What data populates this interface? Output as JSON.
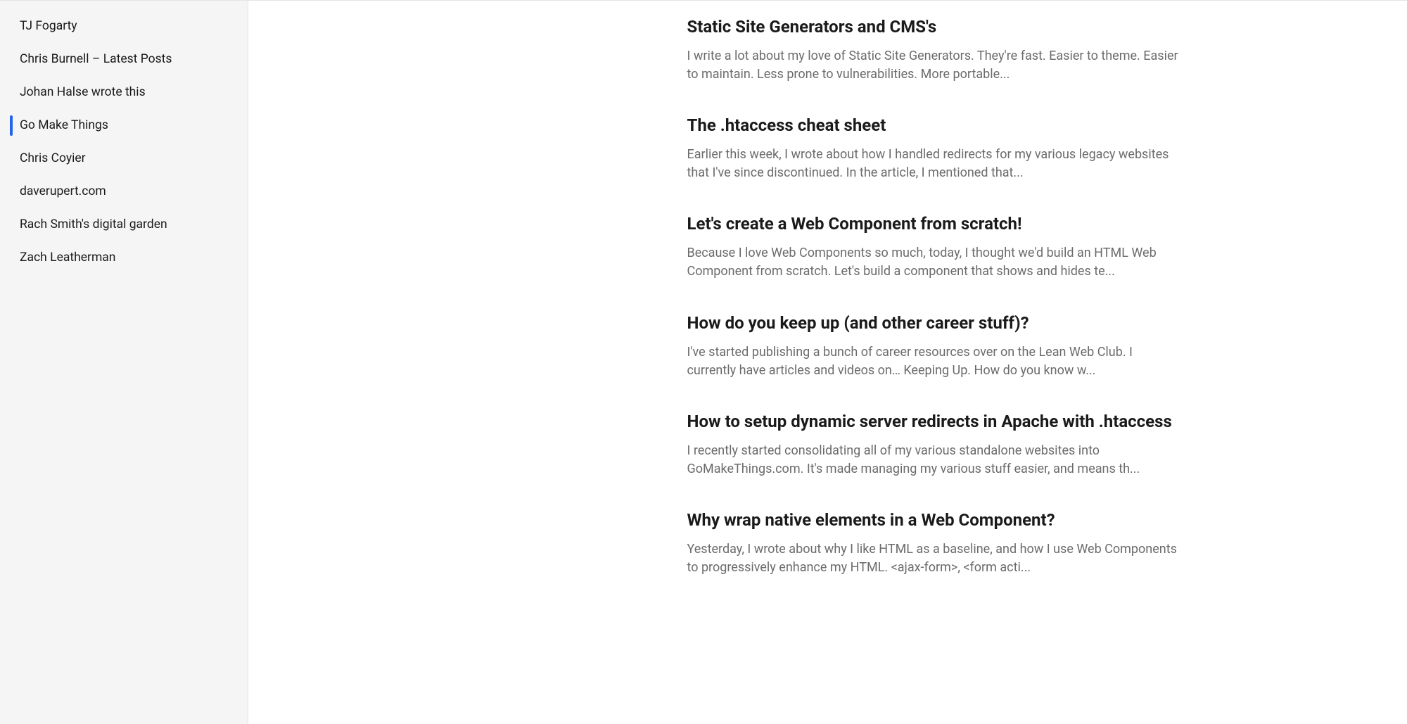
{
  "sidebar": {
    "items": [
      {
        "label": "TJ Fogarty",
        "active": false
      },
      {
        "label": "Chris Burnell – Latest Posts",
        "active": false
      },
      {
        "label": "Johan Halse wrote this",
        "active": false
      },
      {
        "label": "Go Make Things",
        "active": true
      },
      {
        "label": "Chris Coyier",
        "active": false
      },
      {
        "label": "daverupert.com",
        "active": false
      },
      {
        "label": "Rach Smith's digital garden",
        "active": false
      },
      {
        "label": "Zach Leatherman",
        "active": false
      }
    ]
  },
  "articles": [
    {
      "title": "Static Site Generators and CMS's",
      "excerpt": "I write a lot about my love of Static Site Generators. They're fast. Easier to theme. Easier to maintain. Less prone to vulnerabilities. More portable..."
    },
    {
      "title": "The .htaccess cheat sheet",
      "excerpt": "Earlier this week, I wrote about how I handled redirects for my various legacy websites that I've since discontinued. In the article, I mentioned that..."
    },
    {
      "title": "Let's create a Web Component from scratch!",
      "excerpt": "Because I love Web Components so much, today, I thought we'd build an HTML Web Component from scratch. Let's build a component that shows and hides te..."
    },
    {
      "title": "How do you keep up (and other career stuff)?",
      "excerpt": "I've started publishing a bunch of career resources over on the Lean Web Club. I currently have articles and videos on… Keeping Up. How do you know w..."
    },
    {
      "title": "How to setup dynamic server redirects in Apache with .htaccess",
      "excerpt": "I recently started consolidating all of my various standalone websites into GoMakeThings.com. It's made managing my various stuff easier, and means th..."
    },
    {
      "title": "Why wrap native elements in a Web Component?",
      "excerpt": "Yesterday, I wrote about why I like HTML as a baseline, and how I use Web Components to progressively enhance my HTML. <ajax-form>, <form acti..."
    }
  ]
}
